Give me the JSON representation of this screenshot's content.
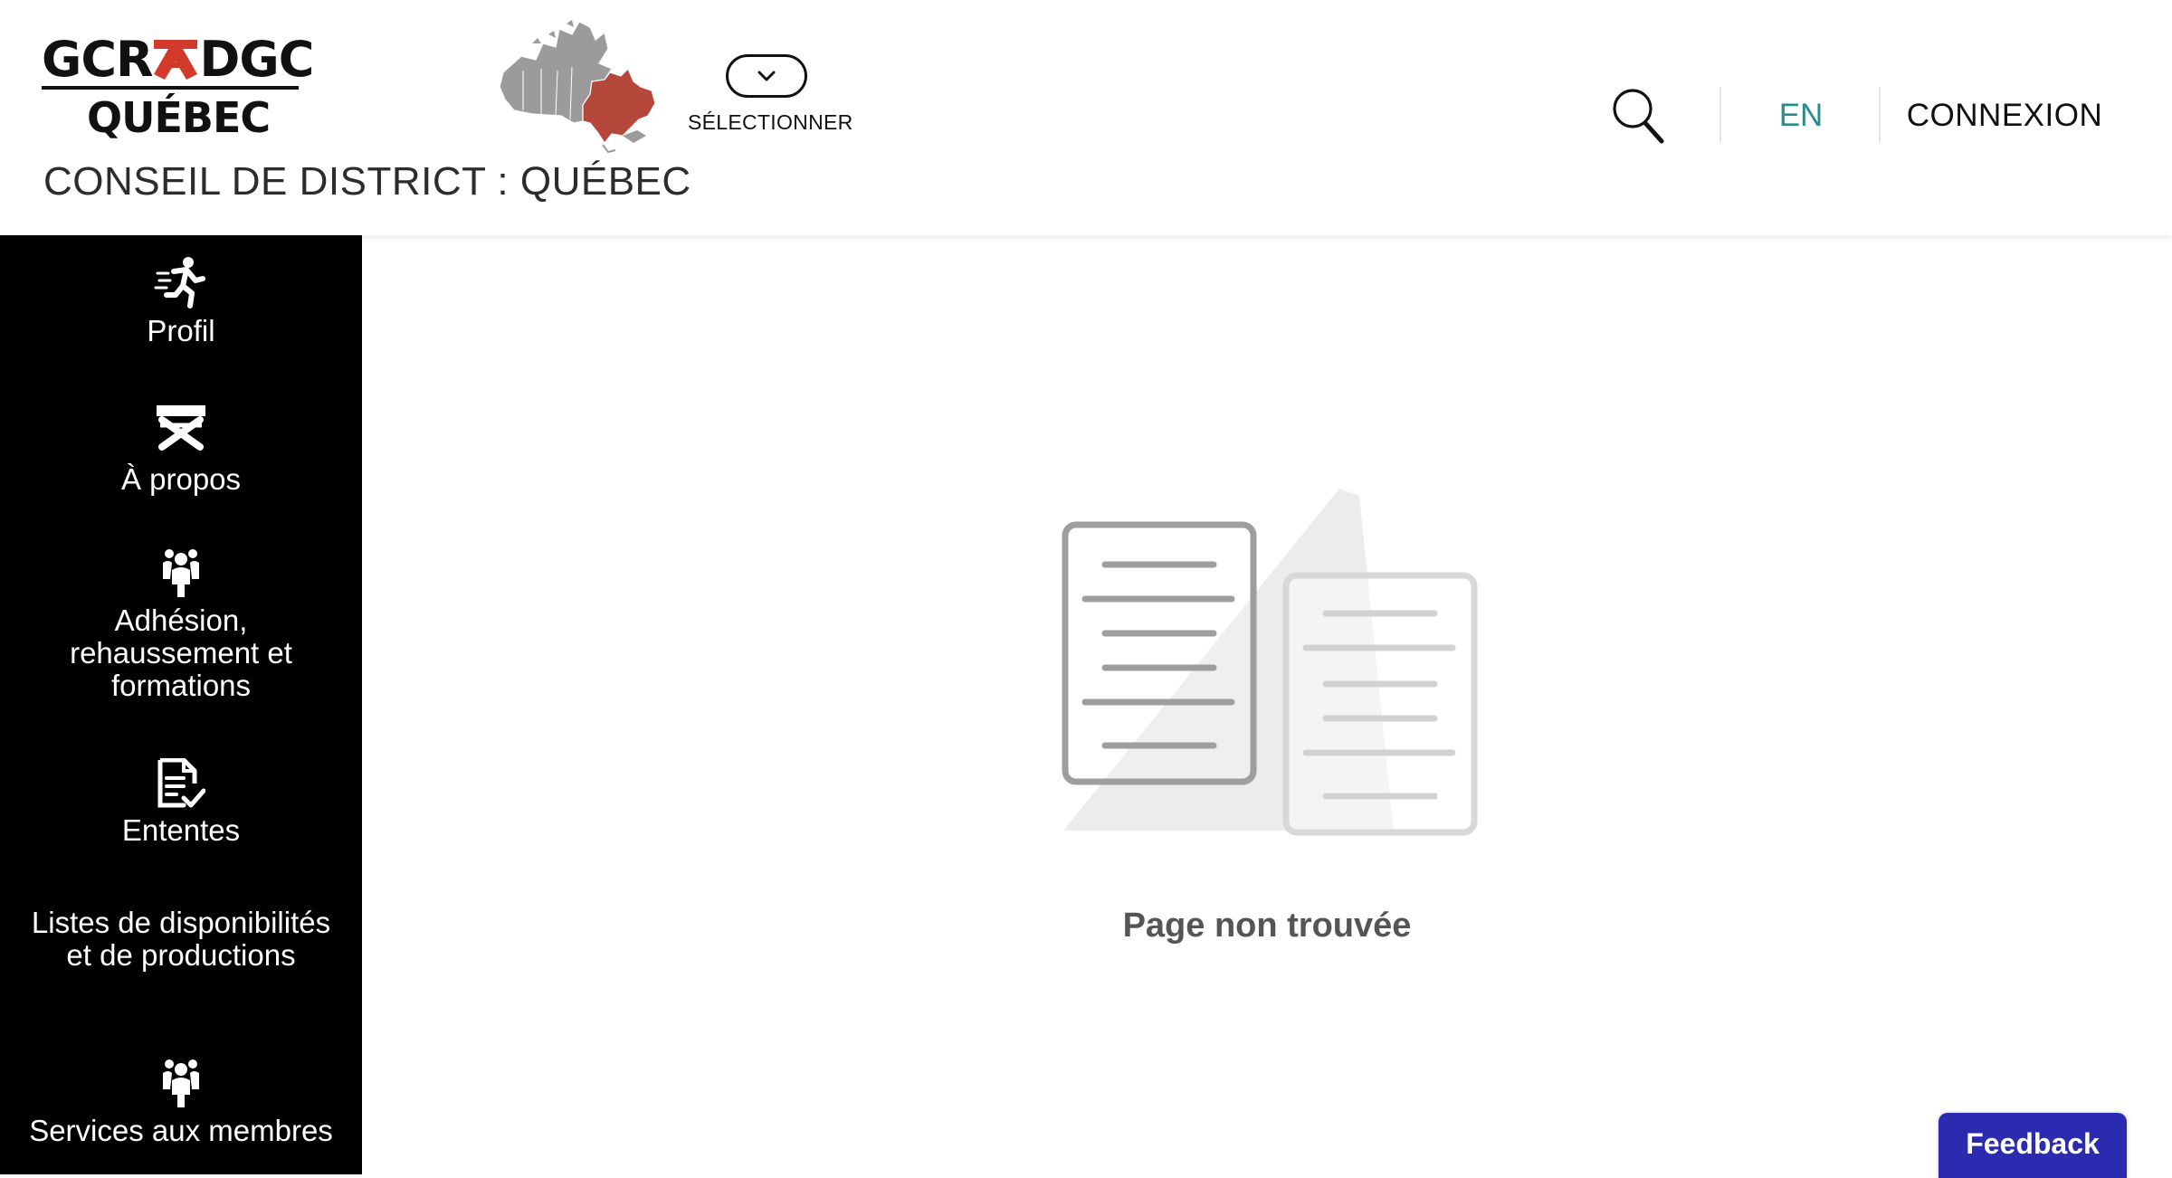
{
  "header": {
    "logo": {
      "left_text": "GCR",
      "right_text": "DGC",
      "bottom_text": "QUÉBEC"
    },
    "district_title": "CONSEIL DE DISTRICT : QUÉBEC",
    "region_selector": {
      "label": "SÉLECTIONNER",
      "icon": "chevron-down-icon"
    },
    "search": {
      "icon": "search-icon"
    },
    "language_toggle": "EN",
    "login": "CONNEXION"
  },
  "sidebar": {
    "items": [
      {
        "label": "Profil",
        "icon": "running-person-icon"
      },
      {
        "label": "À propos",
        "icon": "director-chair-icon"
      },
      {
        "label": "Adhésion, rehaussement et formations",
        "icon": "people-group-icon"
      },
      {
        "label": "Ententes",
        "icon": "document-check-icon"
      },
      {
        "label": "Listes de disponibilités et de productions",
        "icon": ""
      },
      {
        "label": "Services aux membres",
        "icon": "people-group-icon"
      }
    ]
  },
  "main": {
    "message": "Page non trouvée",
    "illustration": "documents-icon"
  },
  "feedback_button": "Feedback",
  "colors": {
    "sidebar_bg": "#000000",
    "accent_teal": "#2a8c8c",
    "brand_red": "#c0392b",
    "feedback_bg": "#2a2bb0"
  }
}
